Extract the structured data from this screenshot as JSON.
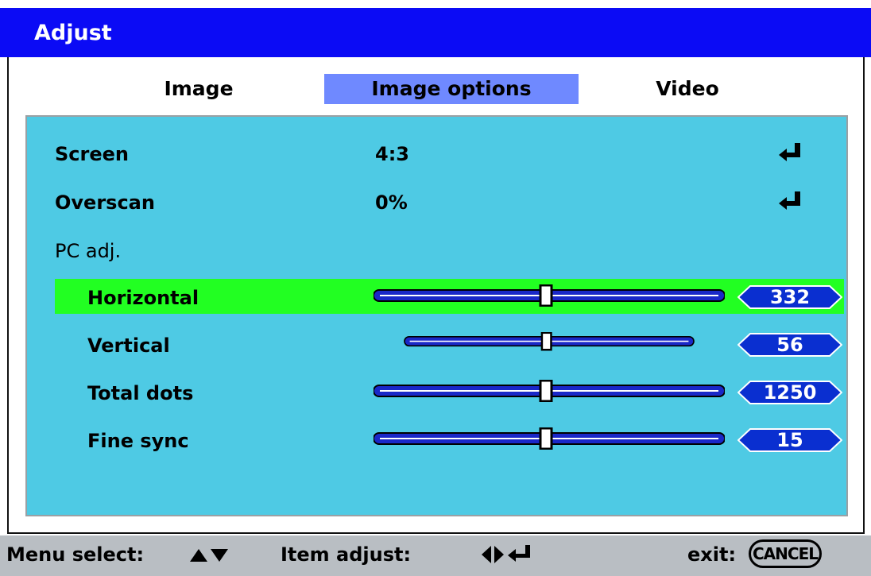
{
  "window": {
    "title": "Adjust"
  },
  "tabs": [
    {
      "label": "Image",
      "active": false
    },
    {
      "label": "Image options",
      "active": true
    },
    {
      "label": "Video",
      "active": false
    }
  ],
  "items": {
    "screen": {
      "label": "Screen",
      "value": "4:3",
      "icon": "enter-icon"
    },
    "overscan": {
      "label": "Overscan",
      "value": "0%",
      "icon": "enter-icon"
    },
    "pc_adj": {
      "label": "PC adj."
    }
  },
  "sliders": [
    {
      "label": "Horizontal",
      "value": "332",
      "position": 0.49,
      "selected": true
    },
    {
      "label": "Vertical",
      "value": "56",
      "position": 0.49,
      "selected": false
    },
    {
      "label": "Total dots",
      "value": "1250",
      "position": 0.49,
      "selected": false
    },
    {
      "label": "Fine sync",
      "value": "15",
      "position": 0.49,
      "selected": false
    }
  ],
  "footer": {
    "menu_select": "Menu select:",
    "item_adjust": "Item adjust:",
    "exit": "exit:",
    "cancel": "CANCEL"
  },
  "colors": {
    "title_bar": "#0b0bf5",
    "active_tab": "#6f89ff",
    "panel": "#4ecae4",
    "highlight": "#22ff22",
    "value_pill": "#0a2fd0",
    "footer": "#b9bec3"
  }
}
